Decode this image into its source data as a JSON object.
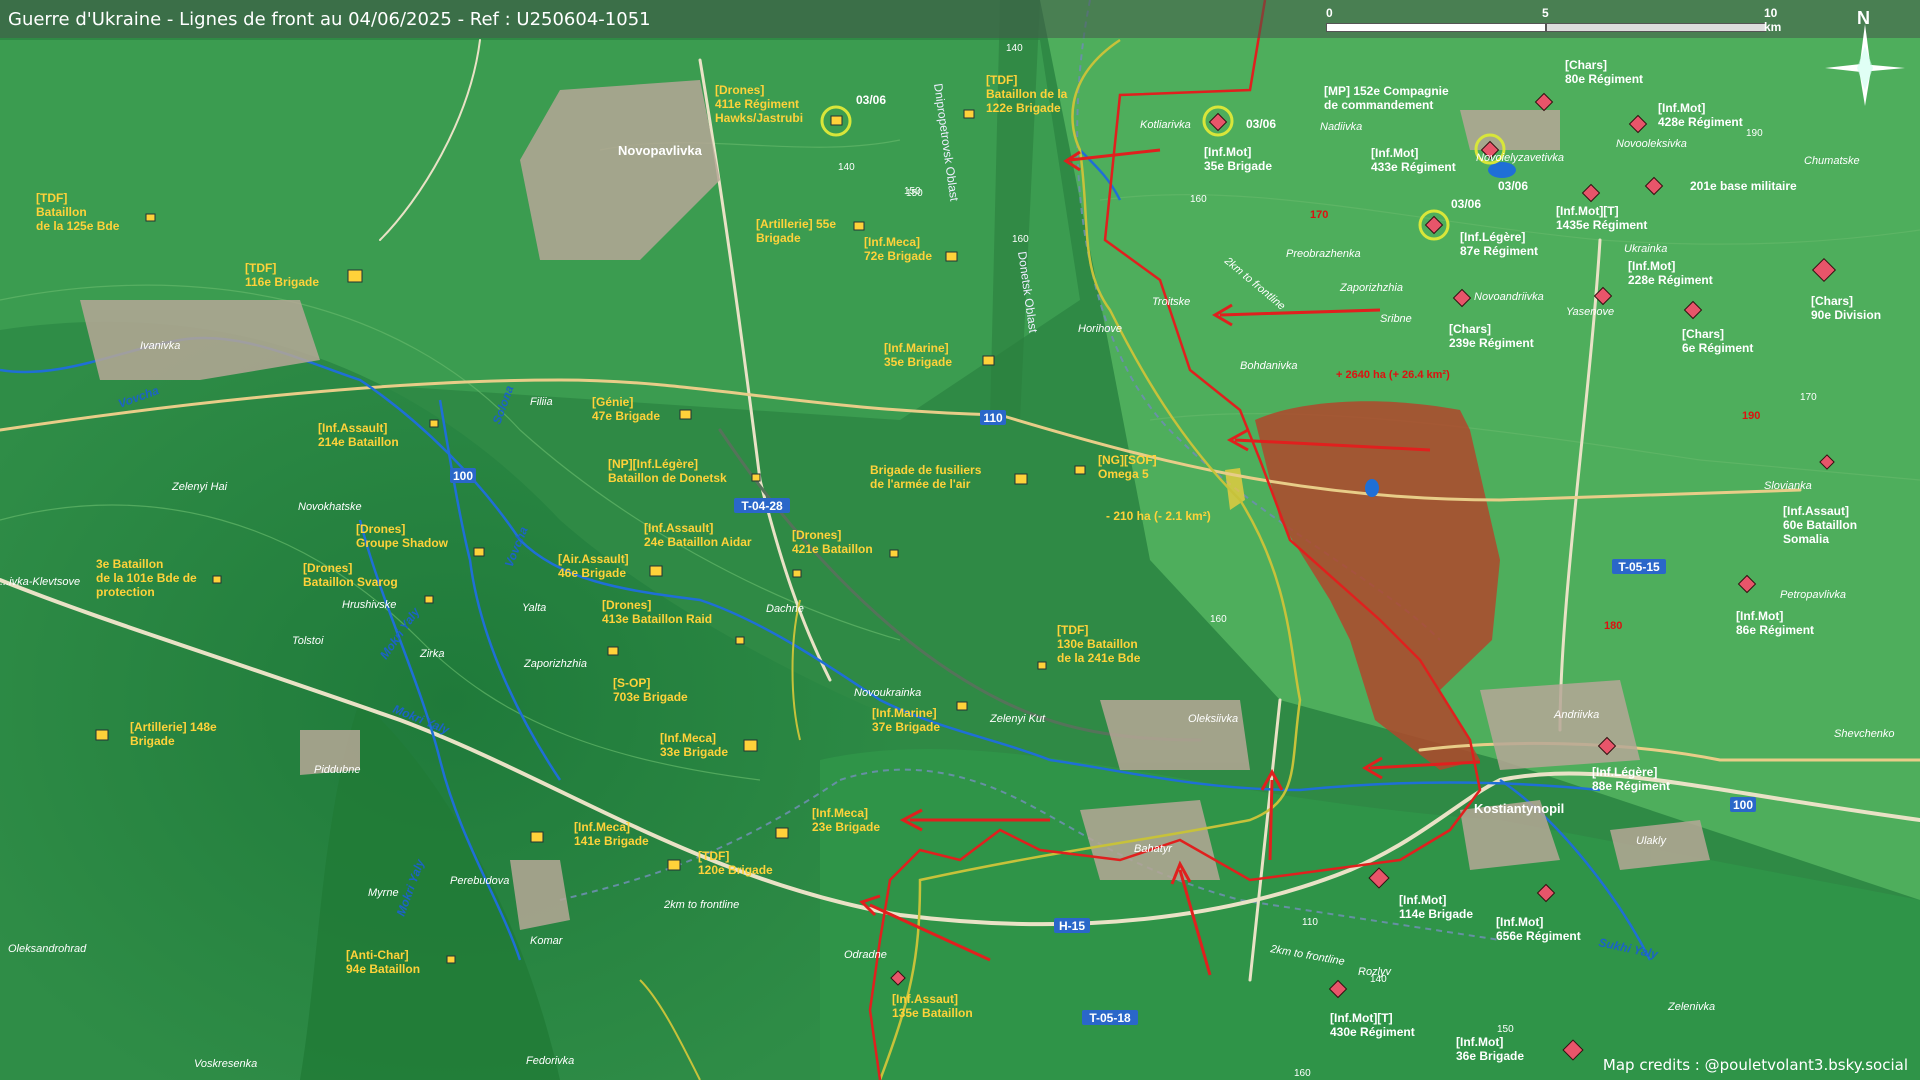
{
  "title": "Guerre d'Ukraine - Lignes de front au 04/06/2025 - Ref : U250604-1051",
  "credits": "Map credits : @pouletvolant3.bsky.social",
  "scale": {
    "labels": [
      "0",
      "5",
      "10 km"
    ]
  },
  "compass": "N",
  "colors": {
    "frontline": "#e0201e",
    "gain": "#b0482c",
    "unit_text": "#ffd23a",
    "road_label": "#2a67c9",
    "water": "#1f6fd6"
  },
  "roads": {
    "t0428": "T-04-28",
    "t0515": "T-05-15",
    "t0518": "T-05-18",
    "h15": "H-15",
    "r100a": "100",
    "r100b": "100",
    "r110": "110"
  },
  "oblasts": {
    "dnipro": "Dnipropetrovsk Oblast",
    "donetsk": "Donetsk Oblast"
  },
  "buffers": {
    "a": "2km to frontline",
    "b": "2km to frontline",
    "c": "2km to frontline"
  },
  "areas": {
    "gain": "+ 2640 ha (+ 26.4 km²)",
    "loss": "- 210 ha (- 2.1 km²)"
  },
  "dates": {
    "d1": "03/06",
    "d2": "03/06",
    "d3": "03/06",
    "d4": "03/06"
  },
  "contours": [
    "140",
    "140",
    "150",
    "160",
    "160",
    "160",
    "170",
    "170",
    "190",
    "190",
    "180",
    "160",
    "110",
    "140",
    "150",
    "150",
    "100"
  ],
  "rivers": {
    "vovcha": "Vovcha",
    "solona": "Solona",
    "vovcha2": "Vovcha",
    "mokri1": "Mokri Yaly",
    "mokri2": "Mokri Yaly",
    "mokri3": "Mokri Yaly",
    "sukhi": "Sukhi Yaly"
  },
  "places": {
    "novopavlivka": "Novopavlivka",
    "ivanivka": "Ivanivka",
    "filiia": "Filiia",
    "zelenyi_hai": "Zelenyi Hai",
    "novokhatske": "Novokhatske",
    "kleviv": "...ivka-Klevtsove",
    "hrushivske": "Hrushivske",
    "tolstoi": "Tolstoi",
    "yalta": "Yalta",
    "zirka": "Zirka",
    "dachne": "Dachne",
    "zaporizhzhia_w": "Zaporizhzhia",
    "piddubne": "Piddubne",
    "perebudova": "Perebudova",
    "myrne": "Myrne",
    "komar": "Komar",
    "oleksandrohrad": "Oleksandrohrad",
    "voskresenka": "Voskresenka",
    "fedorivka": "Fedorivka",
    "odradne": "Odradne",
    "bahatyr": "Bahatyr",
    "novoukrainka": "Novoukrainka",
    "zelenyi_kut": "Zelenyi Kut",
    "oleksiivka": "Oleksiivka",
    "horihove": "Horihove",
    "troitske": "Troitske",
    "bohdanivka": "Bohdanivka",
    "kotliarivka": "Kotliarivka",
    "nadiivka": "Nadiivka",
    "preobrazhenka": "Preobrazhenka",
    "zaporizhzhia_e": "Zaporizhzhia",
    "sribne": "Sribne",
    "novoielyzavetivka": "Novoielyzavetivka",
    "novooleksivka": "Novooleksivka",
    "chumatske": "Chumatske",
    "ukrainka": "Ukrainka",
    "novoandriivka": "Novoandriivka",
    "yasenove": "Yasenove",
    "sloviank": "Slovianka",
    "petropavlivka": "Petropavlivka",
    "andriivka": "Andriivka",
    "shevchenko": "Shevchenko",
    "kostiantynopil": "Kostiantynopil",
    "ulakly": "Ulakly",
    "rozlyv": "Rozlyv",
    "zelenivka": "Zelenivka"
  },
  "units": {
    "drones411": [
      "[Drones]",
      "411e Régiment",
      "Hawks/Jastrubi"
    ],
    "tdf122": [
      "[TDF]",
      "Bataillon de la",
      "122e Brigade"
    ],
    "tdf125": [
      "[TDF]",
      "Bataillon",
      "de la 125e Bde"
    ],
    "tdf116": [
      "[TDF]",
      "116e Brigade"
    ],
    "art55": [
      "[Artillerie] 55e",
      "Brigade"
    ],
    "meca72": [
      "[Inf.Meca]",
      "72e Brigade"
    ],
    "marine35": [
      "[Inf.Marine]",
      "35e Brigade"
    ],
    "genie47": [
      "[Génie]",
      "47e Brigade"
    ],
    "assault214": [
      "[Inf.Assault]",
      "214e Bataillon"
    ],
    "np_donetsk": [
      "[NP][Inf.Légère]",
      "Bataillon de Donetsk"
    ],
    "fusiliers": [
      "Brigade de fusiliers",
      "de l'armée de l'air"
    ],
    "ng_omega": [
      "[NG][SOF]",
      "Omega 5"
    ],
    "drones_shadow": [
      "[Drones]",
      "Groupe Shadow"
    ],
    "drones_svarog": [
      "[Drones]",
      "Bataillon Svarog"
    ],
    "b101": [
      "3e Bataillon",
      "de la 101e Bde de",
      "protection"
    ],
    "aidar": [
      "[Inf.Assault]",
      "24e Bataillon Aidar"
    ],
    "air46": [
      "[Air.Assault]",
      "46e Brigade"
    ],
    "drones421": [
      "[Drones]",
      "421e Bataillon"
    ],
    "raid413": [
      "[Drones]",
      "413e Bataillon Raid"
    ],
    "sop703": [
      "[S-OP]",
      "703e Brigade"
    ],
    "tdf130": [
      "[TDF]",
      "130e Bataillon",
      "de la 241e Bde"
    ],
    "art148": [
      "[Artillerie] 148e",
      "Brigade"
    ],
    "meca33": [
      "[Inf.Meca]",
      "33e Brigade"
    ],
    "marine37": [
      "[Inf.Marine]",
      "37e Brigade"
    ],
    "meca141": [
      "[Inf.Meca]",
      "141e Brigade"
    ],
    "meca23": [
      "[Inf.Meca]",
      "23e Brigade"
    ],
    "tdf120": [
      "[TDF]",
      "120e Brigade"
    ],
    "antichar94": [
      "[Anti-Char]",
      "94e Bataillon"
    ],
    "assault135": [
      "[Inf.Assaut]",
      "135e Bataillon"
    ],
    "mot35": [
      "[Inf.Mot]",
      "35e Brigade"
    ],
    "mp152": [
      "[MP] 152e Compagnie",
      "de commandement"
    ],
    "mot433": [
      "[Inf.Mot]",
      "433e Régiment"
    ],
    "chars80": [
      "[Chars]",
      "80e Régiment"
    ],
    "mot428": [
      "[Inf.Mot]",
      "428e Régiment"
    ],
    "base201": [
      "201e base militaire"
    ],
    "mott1435": [
      "[Inf.Mot][T]",
      "1435e Régiment"
    ],
    "leg87": [
      "[Inf.Légère]",
      "87e Régiment"
    ],
    "mot228": [
      "[Inf.Mot]",
      "228e Régiment"
    ],
    "chars90": [
      "[Chars]",
      "90e Division"
    ],
    "chars239": [
      "[Chars]",
      "239e Régiment"
    ],
    "chars6": [
      "[Chars]",
      "6e Régiment"
    ],
    "assault60": [
      "[Inf.Assaut]",
      "60e Bataillon",
      "Somalia"
    ],
    "mot86": [
      "[Inf.Mot]",
      "86e Régiment"
    ],
    "leg88": [
      "[Inf.Légère]",
      "88e Régiment"
    ],
    "mot114": [
      "[Inf.Mot]",
      "114e Brigade"
    ],
    "mot656": [
      "[Inf.Mot]",
      "656e Régiment"
    ],
    "mott430": [
      "[Inf.Mot][T]",
      "430e Régiment"
    ],
    "mot36": [
      "[Inf.Mot]",
      "36e Brigade"
    ]
  }
}
